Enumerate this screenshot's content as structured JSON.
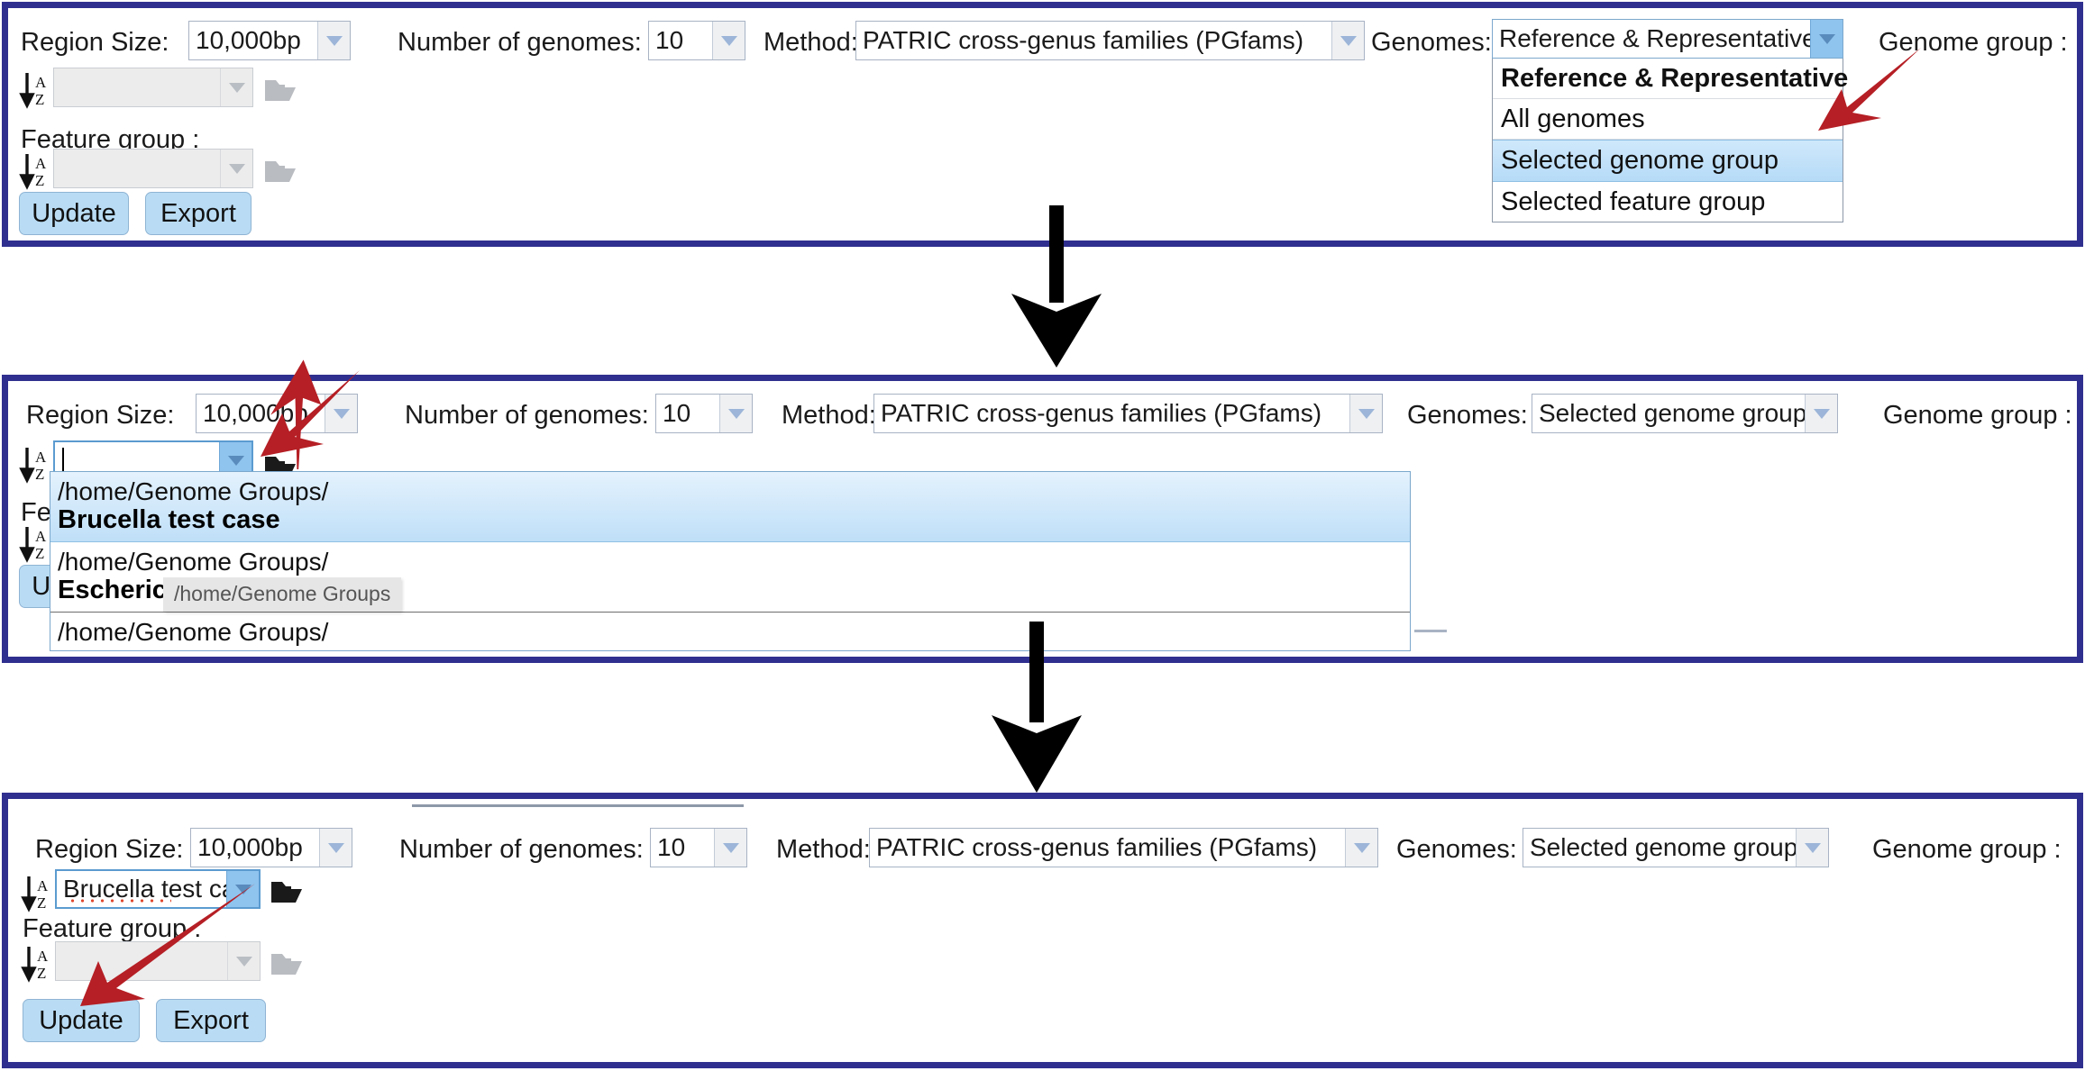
{
  "meta": {
    "accent_blue": "#2f2f8f",
    "highlight_blue": "#b6dbf7",
    "button_blue": "#b9dcf4",
    "annotation_red": "#b51f25"
  },
  "labels": {
    "region_size": "Region Size:",
    "number_of_genomes": "Number of genomes:",
    "method": "Method:",
    "genomes": "Genomes:",
    "genome_group": "Genome group :",
    "feature_group": "Feature group :"
  },
  "values": {
    "region_size": "10,000bp",
    "number_of_genomes": "10",
    "method": "PATRIC cross-genus families (PGfams)",
    "genomes_step1": "Reference & Representative",
    "genomes_step2": "Selected genome group",
    "genomes_step3": "Selected genome group",
    "genome_group_empty": "",
    "genome_group_typed": "",
    "genome_group_selected": "Brucella test case",
    "feature_group_empty": ""
  },
  "buttons": {
    "update": "Update",
    "export": "Export"
  },
  "genomes_dropdown": {
    "options": [
      {
        "label": "Reference & Representative",
        "bold": true,
        "selected": false
      },
      {
        "label": "All genomes",
        "bold": false,
        "selected": false
      },
      {
        "label": "Selected genome group",
        "bold": false,
        "selected": true
      },
      {
        "label": "Selected feature group",
        "bold": false,
        "selected": false
      }
    ]
  },
  "genome_group_autocomplete": {
    "items": [
      {
        "path": "/home/Genome Groups/",
        "name": "Brucella test case",
        "selected": true
      },
      {
        "path": "/home/Genome Groups/",
        "name": "Escherichia_",
        "selected": false
      },
      {
        "path": "/home/Genome Groups/",
        "name": "",
        "selected": false
      }
    ],
    "tooltip": "/home/Genome Groups"
  },
  "icons": {
    "sort_az": "sort-az-icon",
    "folder": "folder-icon",
    "chevron_down": "chevron-down-icon",
    "flow_arrow": "down-arrow-icon",
    "annotation_arrow": "red-pointer-arrow-icon"
  }
}
